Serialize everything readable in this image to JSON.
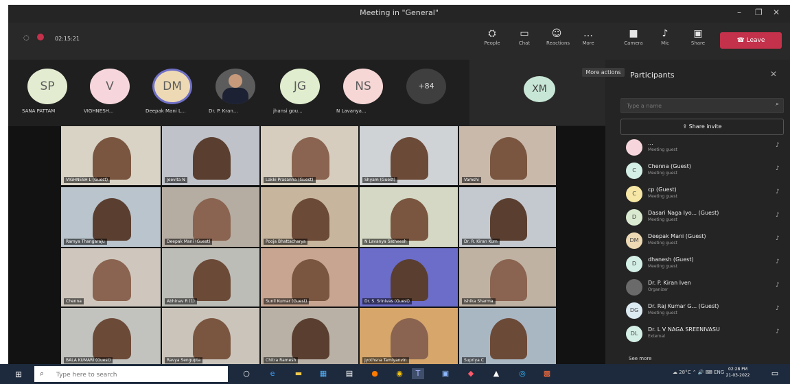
{
  "window": {
    "title": "Meeting in \"General\"",
    "min": "–",
    "max": "❐",
    "close": "✕"
  },
  "toolbar": {
    "timer": "02:15:21",
    "buttons": [
      {
        "label": "People",
        "icon": "⛭"
      },
      {
        "label": "Chat",
        "icon": "▭"
      },
      {
        "label": "Reactions",
        "icon": "☺"
      },
      {
        "label": "More",
        "icon": "…"
      },
      {
        "label": "Camera",
        "icon": "■"
      },
      {
        "label": "Mic",
        "icon": "♪"
      },
      {
        "label": "Share",
        "icon": "▣"
      }
    ],
    "leave": "☎ Leave"
  },
  "strip": {
    "avatars": [
      {
        "initials": "SP",
        "name": "SANA PATTAM",
        "color": "#e3ecd1"
      },
      {
        "initials": "V",
        "name": "VIGHNESH...",
        "color": "#f6d6dc"
      },
      {
        "initials": "DM",
        "name": "Deepak Mani L...",
        "color": "#eddab4"
      },
      {
        "initials": "",
        "name": "Dr. P. Kran...",
        "color": "#5c5c5c"
      },
      {
        "initials": "JG",
        "name": "jhansi gou...",
        "color": "#e0edce"
      },
      {
        "initials": "NS",
        "name": "N Lavanya...",
        "color": "#f7d6d6"
      },
      {
        "initials": "+84",
        "name": "",
        "color": "#3f3f3f"
      }
    ],
    "xm": "XM"
  },
  "tiles": [
    {
      "name": "VIGHNESH L (Guest)"
    },
    {
      "name": "Jeevita N"
    },
    {
      "name": "Lakki Prasanna (Guest)"
    },
    {
      "name": "Shyam (Guest)"
    },
    {
      "name": "Vamshi"
    },
    {
      "name": "Ramya Thangaraju"
    },
    {
      "name": "Deepak Mani (Guest)"
    },
    {
      "name": "Pooja Bhattacharya"
    },
    {
      "name": "N Lavanya Satheesh"
    },
    {
      "name": "Dr. R. Kiran Kum"
    },
    {
      "name": "Chenna"
    },
    {
      "name": "Abhinav R (1)"
    },
    {
      "name": "Sunil Kumar (Guest)"
    },
    {
      "name": "Dr. S. Srinivas (Guest)"
    },
    {
      "name": "Ishika Sharma"
    },
    {
      "name": "BALA KUMARI (Guest)"
    },
    {
      "name": "Ravya Sengupta"
    },
    {
      "name": "Chitra Ramesh"
    },
    {
      "name": "Jyothsna Tamiyanvin"
    },
    {
      "name": "Supriya C"
    }
  ],
  "panel": {
    "title": "Participants",
    "more_actions": "More actions",
    "search_placeholder": "Type a name",
    "share_invite": "Share invite",
    "participants": [
      {
        "initials": "",
        "name": "...",
        "role": "Meeting guest",
        "color": "#f6d6dc"
      },
      {
        "initials": "C",
        "name": "Chenna (Guest)",
        "role": "Meeting guest",
        "color": "#d4efe6"
      },
      {
        "initials": "C",
        "name": "cp (Guest)",
        "role": "Meeting guest",
        "color": "#f7e7a6"
      },
      {
        "initials": "D",
        "name": "Dasari Naga Iyo... (Guest)",
        "role": "Meeting guest",
        "color": "#d9ead0"
      },
      {
        "initials": "DM",
        "name": "Deepak Mani (Guest)",
        "role": "Meeting guest",
        "color": "#eddab4"
      },
      {
        "initials": "D",
        "name": "dhanesh (Guest)",
        "role": "Meeting guest",
        "color": "#d4efe6"
      },
      {
        "initials": "",
        "name": "Dr. P. Kiran Iven",
        "role": "Organizer",
        "color": "#6a6a6a"
      },
      {
        "initials": "DG",
        "name": "Dr. Raj Kumar G... (Guest)",
        "role": "Meeting guest",
        "color": "#dceaf2"
      },
      {
        "initials": "DL",
        "name": "Dr. L V NAGA SREENIVASU",
        "role": "External",
        "color": "#d4efe6"
      }
    ],
    "see_more": "See more"
  },
  "taskbar": {
    "search_placeholder": "Type here to search",
    "time": "02:28 PM",
    "date": "21-03-2022",
    "tray": "☁ 28°C  ⌃  🔊 ⌨ ENG"
  }
}
